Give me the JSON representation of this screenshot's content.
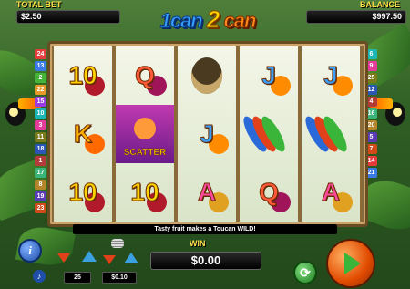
{
  "header": {
    "total_bet_label": "TOTAL BET",
    "total_bet_value": "$2.50",
    "balance_label": "BALANCE",
    "balance_value": "$997.50",
    "title_part1": "1can",
    "title_part2": "2",
    "title_part3": "can"
  },
  "paylines": {
    "left": [
      "24",
      "13",
      "2",
      "22",
      "15",
      "10",
      "3",
      "11",
      "18",
      "1",
      "17",
      "8",
      "19",
      "23"
    ],
    "right": [
      "6",
      "9",
      "25",
      "12",
      "4",
      "16",
      "20",
      "5",
      "7",
      "14",
      "21"
    ],
    "colors": [
      "#e53b3b",
      "#3a7be5",
      "#45b53a",
      "#e59a2a",
      "#9a3ae5",
      "#1ab7b7",
      "#e53b9a",
      "#7a7a1a",
      "#2a56b5",
      "#b53a3a",
      "#3ab57a",
      "#b5852a",
      "#5a3ab5",
      "#d14a1a"
    ]
  },
  "reels": [
    [
      "10",
      "K",
      "10"
    ],
    [
      "Q",
      "SCATTER",
      "10"
    ],
    [
      "toucan",
      "J",
      "A"
    ],
    [
      "J",
      "feathers",
      "Q"
    ],
    [
      "J",
      "feathers",
      "A"
    ]
  ],
  "message": "Tasty fruit makes a Toucan WILD!",
  "win": {
    "label": "WIN",
    "value": "$0.00"
  },
  "controls": {
    "lines_value": "25",
    "coin_value": "$0.10"
  },
  "colors": {
    "gold": "#ffe14a",
    "spin_orange": "#f06a10",
    "play_green": "#3ab53a"
  }
}
